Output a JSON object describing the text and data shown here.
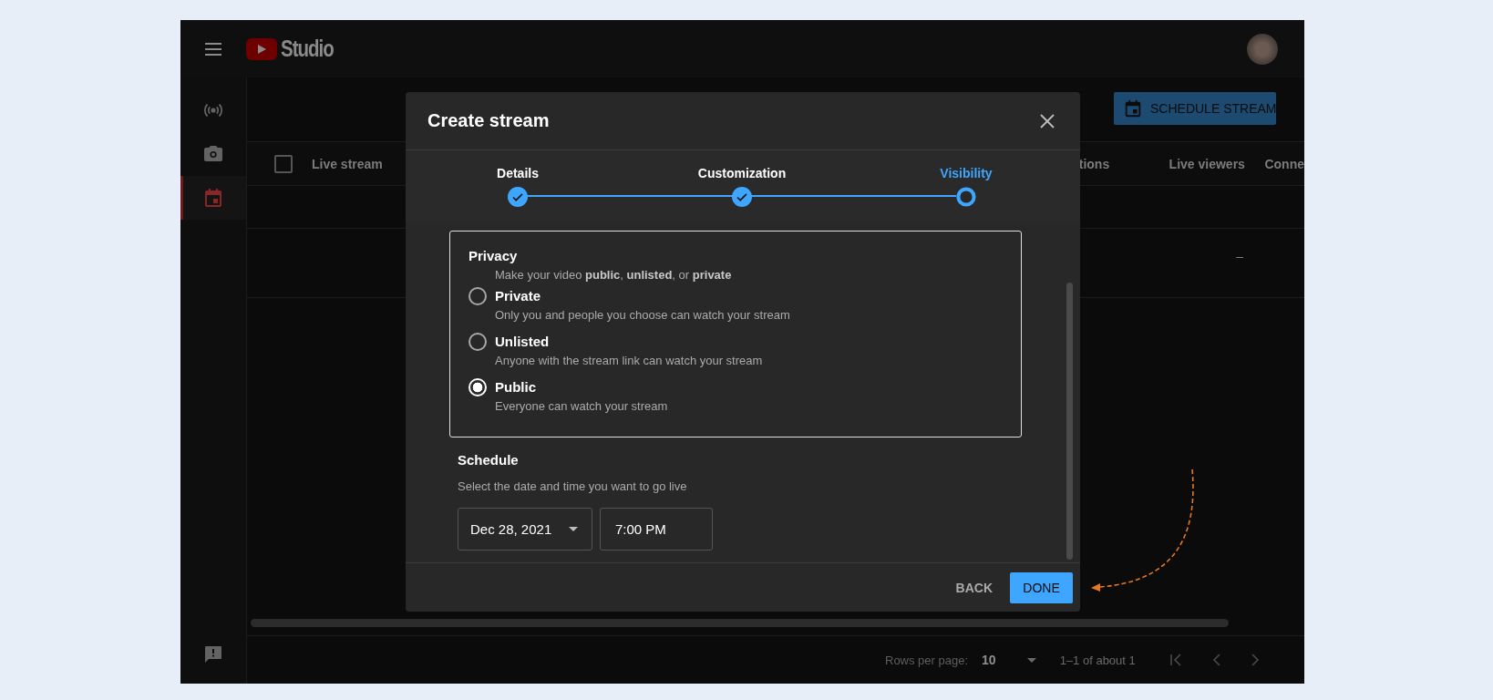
{
  "header": {
    "logo_text": "Studio"
  },
  "sidebar": {
    "items": [
      {
        "kind": "broadcast",
        "selected": false
      },
      {
        "kind": "camera",
        "selected": false
      },
      {
        "kind": "calendar",
        "selected": true
      }
    ],
    "feedback": {
      "kind": "feedback"
    }
  },
  "toolbar": {
    "schedule_button": "SCHEDULE STREAM"
  },
  "table": {
    "select_all": {
      "checked": false
    },
    "columns": [
      {
        "label": "Live stream",
        "kind": "name"
      },
      {
        "label": "tions",
        "kind": "column_3"
      },
      {
        "label": "Live viewers",
        "kind": "viewers"
      },
      {
        "label": "Conne",
        "kind": "column_5"
      }
    ],
    "rows": [
      {
        "live_viewers": "–"
      }
    ]
  },
  "pagination": {
    "rows_per_page_label": "Rows per page:",
    "rows_per_page": "10",
    "range": "1–1 of about 1"
  },
  "dialog": {
    "title": "Create stream",
    "steps": [
      {
        "label": "Details",
        "done": true,
        "selected": false
      },
      {
        "label": "Customization",
        "done": true,
        "selected": false
      },
      {
        "label": "Visibility",
        "done": false,
        "selected": true
      }
    ],
    "privacy": {
      "title": "Privacy",
      "hint": "Make your video **public**, **unlisted**, or **private**",
      "options": [
        {
          "label": "Private",
          "description": "Only you and people you choose can watch your stream",
          "selected": false
        },
        {
          "label": "Unlisted",
          "description": "Anyone with the stream link can watch your stream",
          "selected": false
        },
        {
          "label": "Public",
          "description": "Everyone can watch your stream",
          "selected": true
        }
      ]
    },
    "schedule": {
      "title": "Schedule",
      "hint": "Select the date and time you want to go live",
      "date": "Dec 28, 2021",
      "time": "7:00 PM"
    },
    "buttons": [
      {
        "label": "BACK",
        "kind": "text"
      },
      {
        "label": "DONE",
        "kind": "primary"
      }
    ]
  }
}
